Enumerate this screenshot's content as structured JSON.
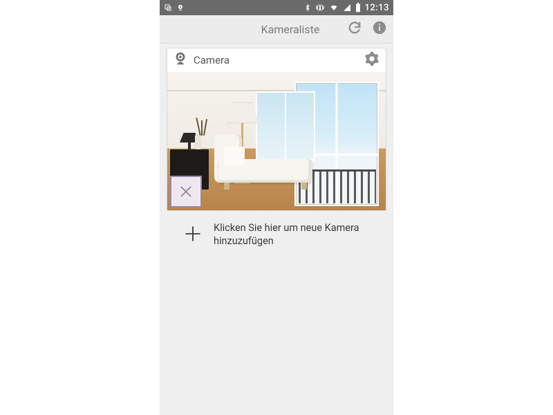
{
  "statusbar": {
    "time": "12:13",
    "icons": {
      "notification1": "app-notif-icon",
      "notification2": "camera-notif-icon",
      "bluetooth": "bluetooth-icon",
      "vibrate": "vibrate-icon",
      "wifi": "wifi-icon",
      "signal": "signal-icon",
      "battery": "battery-icon"
    }
  },
  "header": {
    "title": "Kameraliste",
    "refresh_label": "Refresh",
    "info_label": "Info"
  },
  "cameras": [
    {
      "name": "Camera",
      "settings_label": "Settings",
      "preview_alt": "Living room camera preview"
    }
  ],
  "add_camera": {
    "label": "Klicken Sie hier um neue Kamera hinzuzufügen"
  }
}
